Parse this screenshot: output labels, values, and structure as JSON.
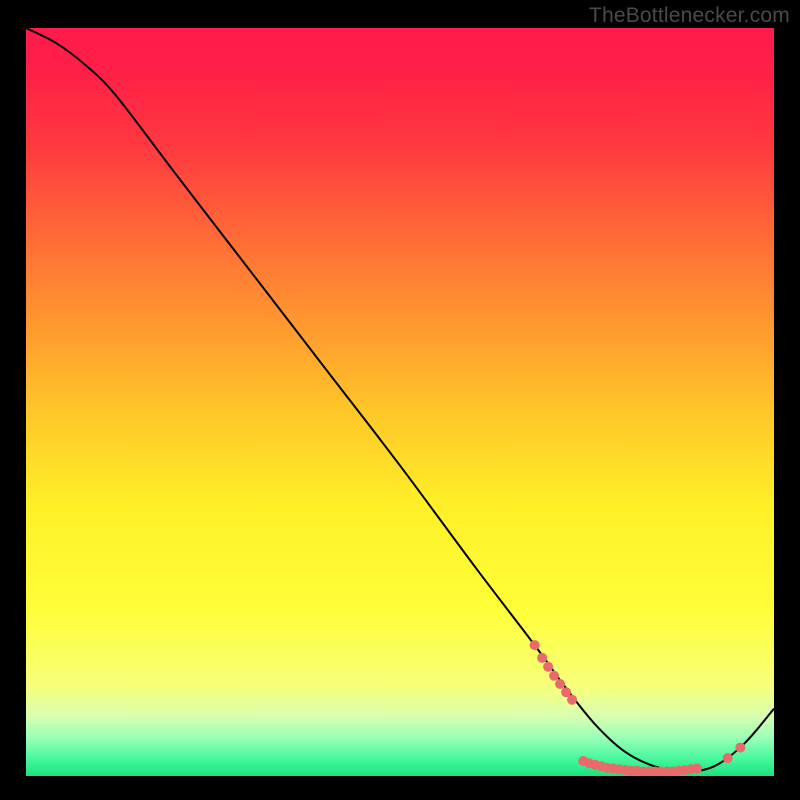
{
  "attribution": "TheBottlenecker.com",
  "chart_data": {
    "type": "line",
    "title": "",
    "xlabel": "",
    "ylabel": "",
    "xlim": [
      0,
      100
    ],
    "ylim": [
      0,
      100
    ],
    "background_gradient": {
      "stops": [
        {
          "offset": 0.0,
          "color": "#ff1a4d"
        },
        {
          "offset": 0.06,
          "color": "#ff2047"
        },
        {
          "offset": 0.16,
          "color": "#ff3a3f"
        },
        {
          "offset": 0.28,
          "color": "#ff6b37"
        },
        {
          "offset": 0.4,
          "color": "#ff9a2f"
        },
        {
          "offset": 0.52,
          "color": "#ffc929"
        },
        {
          "offset": 0.64,
          "color": "#fff028"
        },
        {
          "offset": 0.78,
          "color": "#ffff3a"
        },
        {
          "offset": 0.88,
          "color": "#f7ff7a"
        },
        {
          "offset": 0.92,
          "color": "#d8ffb0"
        },
        {
          "offset": 0.95,
          "color": "#97ffb6"
        },
        {
          "offset": 0.975,
          "color": "#4cf99f"
        },
        {
          "offset": 1.0,
          "color": "#18e27d"
        }
      ]
    },
    "series": [
      {
        "name": "curve",
        "color": "#000000",
        "x": [
          0,
          4,
          8,
          12,
          20,
          30,
          40,
          50,
          60,
          68,
          72,
          76,
          80,
          84,
          88,
          92,
          96,
          100
        ],
        "y": [
          100,
          98,
          95,
          91,
          80.5,
          67.5,
          54.5,
          41.5,
          28,
          17.5,
          12,
          7,
          3.3,
          1.3,
          0.6,
          1.3,
          4.3,
          9
        ]
      }
    ],
    "markers": {
      "name": "highlight-dots",
      "color": "#e86a6a",
      "radius_px": 5,
      "points": [
        {
          "x": 68.0,
          "y": 17.5
        },
        {
          "x": 69.0,
          "y": 15.8
        },
        {
          "x": 69.8,
          "y": 14.6
        },
        {
          "x": 70.6,
          "y": 13.4
        },
        {
          "x": 71.4,
          "y": 12.3
        },
        {
          "x": 72.2,
          "y": 11.2
        },
        {
          "x": 73.0,
          "y": 10.2
        },
        {
          "x": 74.5,
          "y": 2.0
        },
        {
          "x": 75.3,
          "y": 1.7
        },
        {
          "x": 76.1,
          "y": 1.5
        },
        {
          "x": 76.9,
          "y": 1.3
        },
        {
          "x": 77.7,
          "y": 1.1
        },
        {
          "x": 78.5,
          "y": 1.0
        },
        {
          "x": 79.3,
          "y": 0.9
        },
        {
          "x": 80.1,
          "y": 0.8
        },
        {
          "x": 80.9,
          "y": 0.7
        },
        {
          "x": 81.7,
          "y": 0.7
        },
        {
          "x": 82.5,
          "y": 0.6
        },
        {
          "x": 83.3,
          "y": 0.6
        },
        {
          "x": 84.1,
          "y": 0.6
        },
        {
          "x": 84.9,
          "y": 0.6
        },
        {
          "x": 85.7,
          "y": 0.6
        },
        {
          "x": 86.5,
          "y": 0.6
        },
        {
          "x": 87.3,
          "y": 0.7
        },
        {
          "x": 88.1,
          "y": 0.8
        },
        {
          "x": 88.9,
          "y": 0.9
        },
        {
          "x": 89.7,
          "y": 1.0
        },
        {
          "x": 93.8,
          "y": 2.4
        },
        {
          "x": 95.5,
          "y": 3.8
        }
      ]
    }
  }
}
